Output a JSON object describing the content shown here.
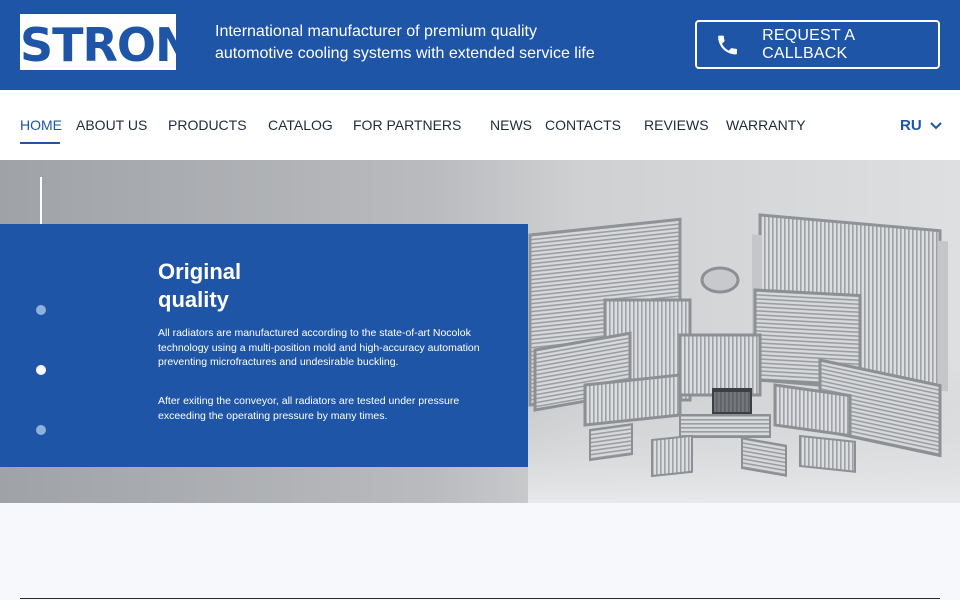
{
  "header": {
    "logo_text": "STRON",
    "tagline_line1": "International manufacturer of premium quality",
    "tagline_line2": "automotive cooling systems with extended service life",
    "callback_label": "REQUEST A CALLBACK",
    "brand_color": "#1f55a6"
  },
  "nav": {
    "items": [
      {
        "label": "HOME"
      },
      {
        "label": "ABOUT US"
      },
      {
        "label": "PRODUCTS"
      },
      {
        "label": "CATALOG"
      },
      {
        "label": "FOR PARTNERS"
      },
      {
        "label": "NEWS"
      },
      {
        "label": "CONTACTS"
      },
      {
        "label": "REVIEWS"
      },
      {
        "label": "WARRANTY"
      }
    ],
    "active": "HOME",
    "language": "RU"
  },
  "hero": {
    "title_line1": "Original",
    "title_line2": "quality",
    "paragraph1": "All radiators are manufactured according to the state-of-art Nocolok technology using a multi-position mold and high-accuracy automation preventing microfractures and undesirable buckling.",
    "paragraph2": "After exiting the conveyor, all radiators are tested under pressure exceeding the operating pressure by many times.",
    "slide_count": 3,
    "active_slide": 2
  }
}
